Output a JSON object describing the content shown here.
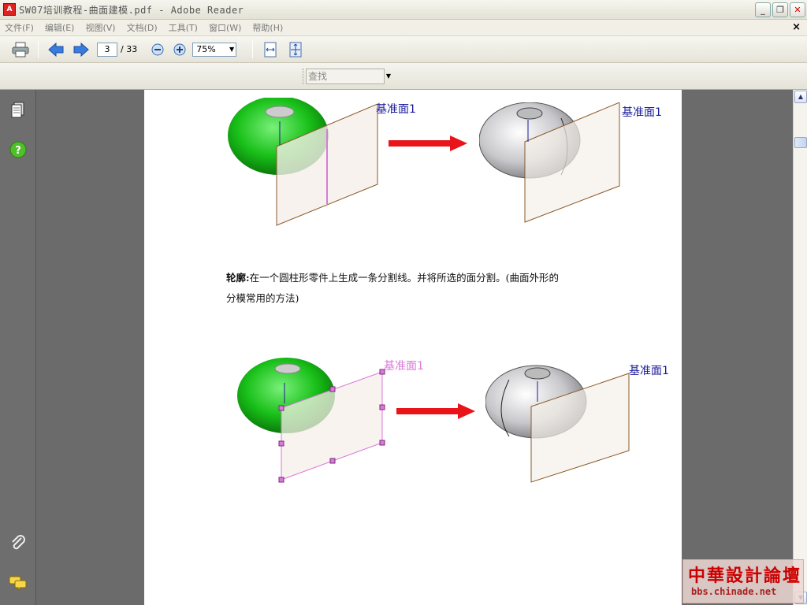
{
  "window": {
    "title": "SW07培训教程-曲面建模.pdf - Adobe Reader",
    "app_icon": "pdf-icon"
  },
  "menu": {
    "items": [
      "文件(F)",
      "编辑(E)",
      "视图(V)",
      "文档(D)",
      "工具(T)",
      "窗口(W)",
      "帮助(H)"
    ],
    "close_glyph": "×"
  },
  "toolbar": {
    "current_page": "3",
    "total_pages": "/ 33",
    "zoom": "75%"
  },
  "find": {
    "placeholder": "查找"
  },
  "document": {
    "figure1": {
      "left_label": "基准面1",
      "right_label": "基准面1"
    },
    "paragraph": {
      "heading": "轮廓:",
      "body_line1": "在一个圆柱形零件上生成一条分割线。并将所选的面分割。(曲面外形的",
      "body_line2": "分模常用的方法)"
    },
    "figure2": {
      "left_label": "基准面1",
      "right_label": "基准面1"
    }
  },
  "watermark": {
    "line1": "中華設計論壇",
    "line2": "bbs.chinade.net"
  },
  "colors": {
    "accent_red": "#e8141a",
    "shell_green": "#27c527",
    "label_blue": "#1a1a9a",
    "plane_edge": "#8b5a2b"
  }
}
